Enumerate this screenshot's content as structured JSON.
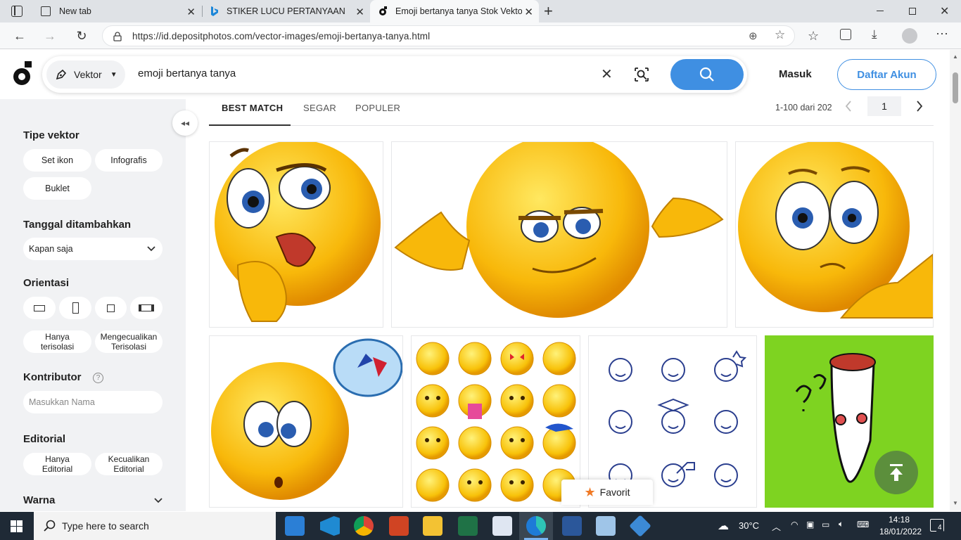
{
  "browser": {
    "tabs": [
      {
        "title": "New tab"
      },
      {
        "title": "STIKER LUCU PERTANYAAN - Bin"
      },
      {
        "title": "Emoji bertanya tanya Stok Vekto"
      }
    ],
    "url": "https://id.depositphotos.com/vector-images/emoji-bertanya-tanya.html"
  },
  "header": {
    "type_selector": "Vektor",
    "search_query": "emoji bertanya tanya",
    "login": "Masuk",
    "register": "Daftar Akun"
  },
  "sidebar": {
    "vector_type": {
      "heading": "Tipe vektor",
      "options": [
        "Set ikon",
        "Infografis",
        "Buklet"
      ]
    },
    "date_added": {
      "heading": "Tanggal ditambahkan",
      "value": "Kapan saja"
    },
    "orientation": {
      "heading": "Orientasi",
      "isolated_only": "Hanya terisolasi",
      "exclude_isolated": "Mengecualikan Terisolasi"
    },
    "contributor": {
      "heading": "Kontributor",
      "placeholder": "Masukkan Nama"
    },
    "editorial": {
      "heading": "Editorial",
      "only": "Hanya Editorial",
      "exclude": "Kecualikan Editorial"
    },
    "color": {
      "heading": "Warna"
    }
  },
  "results": {
    "sort_tabs": [
      "BEST MATCH",
      "SEGAR",
      "POPULER"
    ],
    "range": "1-100 dari 202",
    "page": "1"
  },
  "favorite_label": "Favorit",
  "taskbar": {
    "search_placeholder": "Type here to search",
    "weather": "30°C",
    "time": "14:18",
    "date": "18/01/2022",
    "notifications": "4"
  },
  "colors": {
    "accent_blue": "#3f8fe2",
    "sidebar_bg": "#f1f2f4",
    "taskbar_bg": "#1f2a36",
    "emoji_yellow": "#f9c20a",
    "green_tile": "#7ed321",
    "scroll_top_green": "#5c8f3c"
  }
}
